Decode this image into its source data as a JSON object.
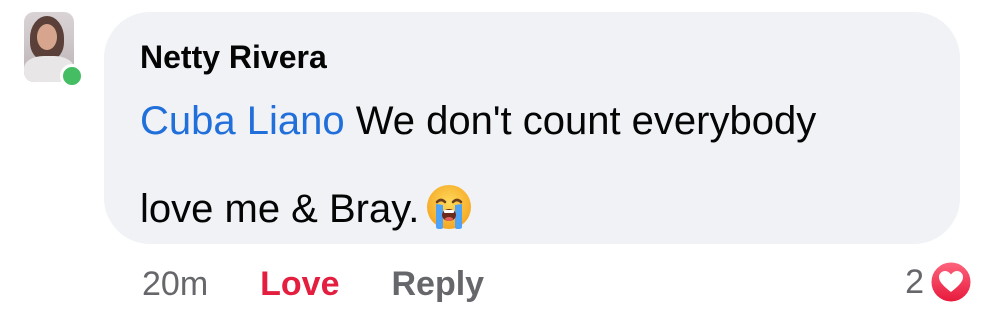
{
  "comment": {
    "author": "Netty Rivera",
    "mention": "Cuba Liano",
    "text_line1": " We don't count everybody",
    "text_line2": "love me & Bray.",
    "emoji": "loudly-crying-face"
  },
  "actions": {
    "timestamp": "20m",
    "love_label": "Love",
    "reply_label": "Reply"
  },
  "reactions": {
    "count": "2",
    "type": "heart-icon"
  },
  "colors": {
    "bubble": "#f0f2f5",
    "mention": "#216fdb",
    "love": "#e41e3f",
    "muted": "#65676b",
    "online": "#45bd62"
  }
}
